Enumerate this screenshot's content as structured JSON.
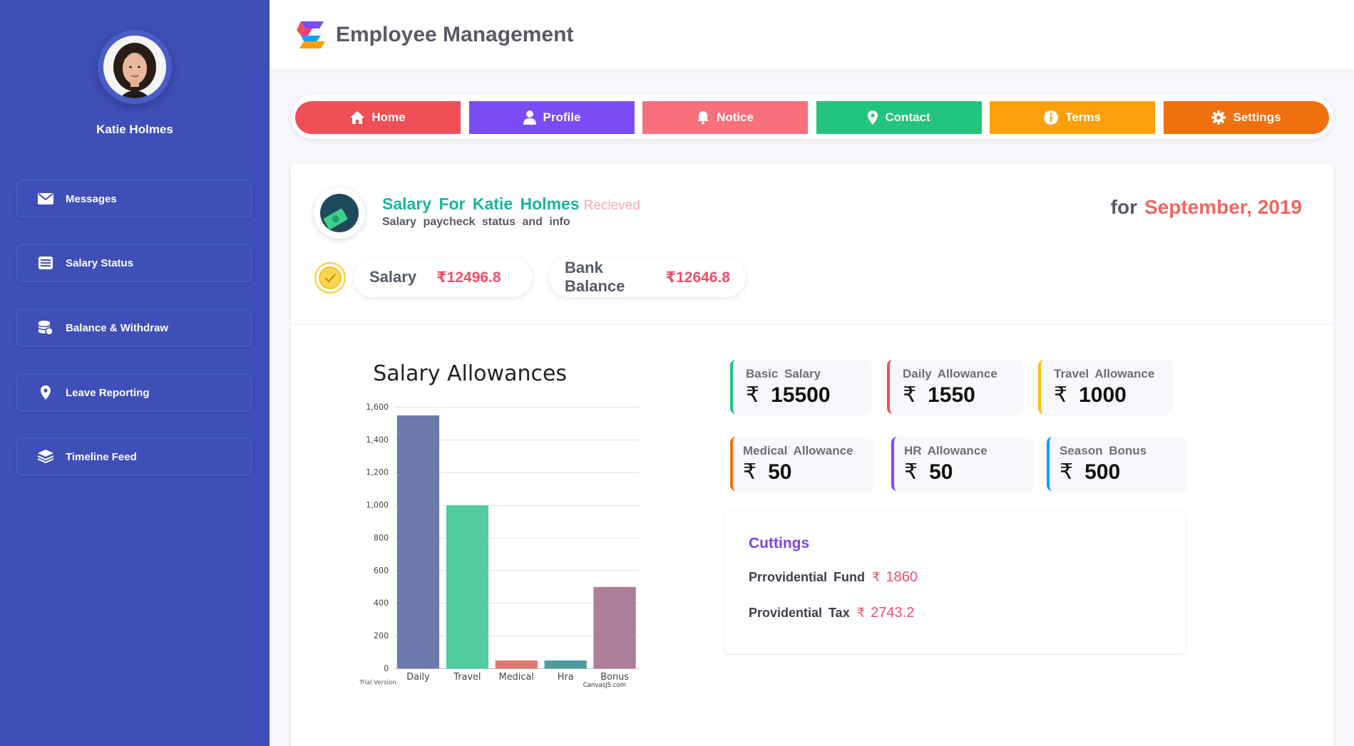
{
  "app": {
    "title": "Employee Management"
  },
  "user": {
    "name": "Katie Holmes"
  },
  "sidebar": {
    "items": [
      {
        "label": "Messages",
        "icon": "envelope-icon"
      },
      {
        "label": "Salary Status",
        "icon": "list-icon"
      },
      {
        "label": "Balance & Withdraw",
        "icon": "coins-icon"
      },
      {
        "label": "Leave Reporting",
        "icon": "map-pin-icon"
      },
      {
        "label": "Timeline Feed",
        "icon": "layers-icon"
      }
    ]
  },
  "nav": {
    "items": [
      {
        "label": "Home",
        "icon": "home-icon",
        "color": "#ef5058"
      },
      {
        "label": "Profile",
        "icon": "user-icon",
        "color": "#7b4cf5"
      },
      {
        "label": "Notice",
        "icon": "bell-icon",
        "color": "#f7707c"
      },
      {
        "label": "Contact",
        "icon": "map-pin-icon",
        "color": "#22c47e"
      },
      {
        "label": "Terms",
        "icon": "info-icon",
        "color": "#fba00b"
      },
      {
        "label": "Settings",
        "icon": "gear-icon",
        "color": "#f07010"
      }
    ]
  },
  "salary": {
    "title": "Salary For Katie Holmes",
    "status": "Recieved",
    "subtitle": "Salary paycheck status and info",
    "for_prefix": "for",
    "month": "September, 2019",
    "salary_label": "Salary",
    "salary_amount": "₹12496.8",
    "balance_label": "Bank Balance",
    "balance_amount": "₹12646.8"
  },
  "currency_symbol": "₹",
  "allowances": [
    {
      "label": "Basic Salary",
      "value": "15500",
      "color": "#22c47e"
    },
    {
      "label": "Daily Allowance",
      "value": "1550",
      "color": "#ef5058"
    },
    {
      "label": "Travel Allowance",
      "value": "1000",
      "color": "#fbbf1a"
    },
    {
      "label": "Medical Allowance",
      "value": "50",
      "color": "#f07010"
    },
    {
      "label": "HR Allowance",
      "value": "50",
      "color": "#7b4cf5"
    },
    {
      "label": "Season Bonus",
      "value": "500",
      "color": "#1a9cf0"
    }
  ],
  "cuttings": {
    "title": "Cuttings",
    "rows": [
      {
        "label": "Prrovidential Fund",
        "amount": "1860"
      },
      {
        "label": "Providential Tax",
        "amount": "2743.2"
      }
    ]
  },
  "chart_data": {
    "type": "bar",
    "title": "Salary Allowances",
    "categories": [
      "Daily",
      "Travel",
      "Medical",
      "Hra",
      "Bonus"
    ],
    "values": [
      1550,
      1000,
      50,
      50,
      500
    ],
    "colors": [
      "#6d78ad",
      "#51cda0",
      "#df7970",
      "#4c9ca0",
      "#ae7d99"
    ],
    "ylim": [
      0,
      1600
    ],
    "yticks": [
      "0",
      "200",
      "400",
      "600",
      "800",
      "1,000",
      "1,200",
      "1,400",
      "1,600"
    ],
    "grid": true,
    "watermark_left": "Trial Version",
    "watermark_right": "CanvasJS.com"
  }
}
